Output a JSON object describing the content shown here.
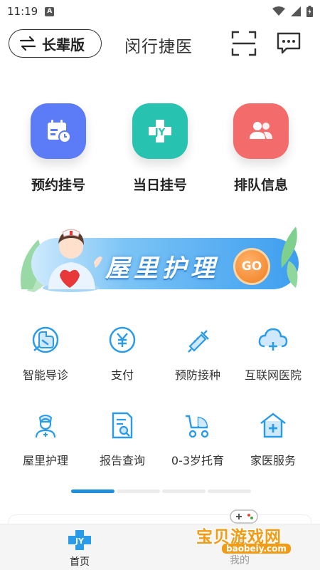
{
  "status_bar": {
    "time": "11:19",
    "notif_letter": "A"
  },
  "header": {
    "elder_mode_label": "长辈版",
    "title": "闵行捷医"
  },
  "quick_actions": [
    {
      "label": "预约挂号",
      "icon": "calendar-clock-icon",
      "color": "#5b7cf6"
    },
    {
      "label": "当日挂号",
      "icon": "medical-cross-icon",
      "color": "#27c2b0"
    },
    {
      "label": "排队信息",
      "icon": "people-queue-icon",
      "color": "#f46b6b"
    }
  ],
  "banner": {
    "text": "屋里护理",
    "button": "GO"
  },
  "services": [
    {
      "label": "智能导诊",
      "icon": "smart-guide-icon"
    },
    {
      "label": "支付",
      "icon": "payment-icon"
    },
    {
      "label": "预防接种",
      "icon": "vaccine-icon"
    },
    {
      "label": "互联网医院",
      "icon": "cloud-hospital-icon"
    },
    {
      "label": "屋里护理",
      "icon": "nurse-icon"
    },
    {
      "label": "报告查询",
      "icon": "report-search-icon"
    },
    {
      "label": "0-3岁托育",
      "icon": "stroller-icon"
    },
    {
      "label": "家医服务",
      "icon": "family-doctor-icon"
    }
  ],
  "pager": {
    "count": 4,
    "active_index": 0
  },
  "bottom_nav": [
    {
      "label": "首页",
      "icon": "home-cross-icon"
    },
    {
      "label": "我的",
      "icon": "profile-icon"
    }
  ],
  "watermark": {
    "title": "宝贝游戏网",
    "url": "baobeiy.com"
  },
  "colors": {
    "accent": "#1e8fd8",
    "icon_blue": "#2a9be8"
  }
}
